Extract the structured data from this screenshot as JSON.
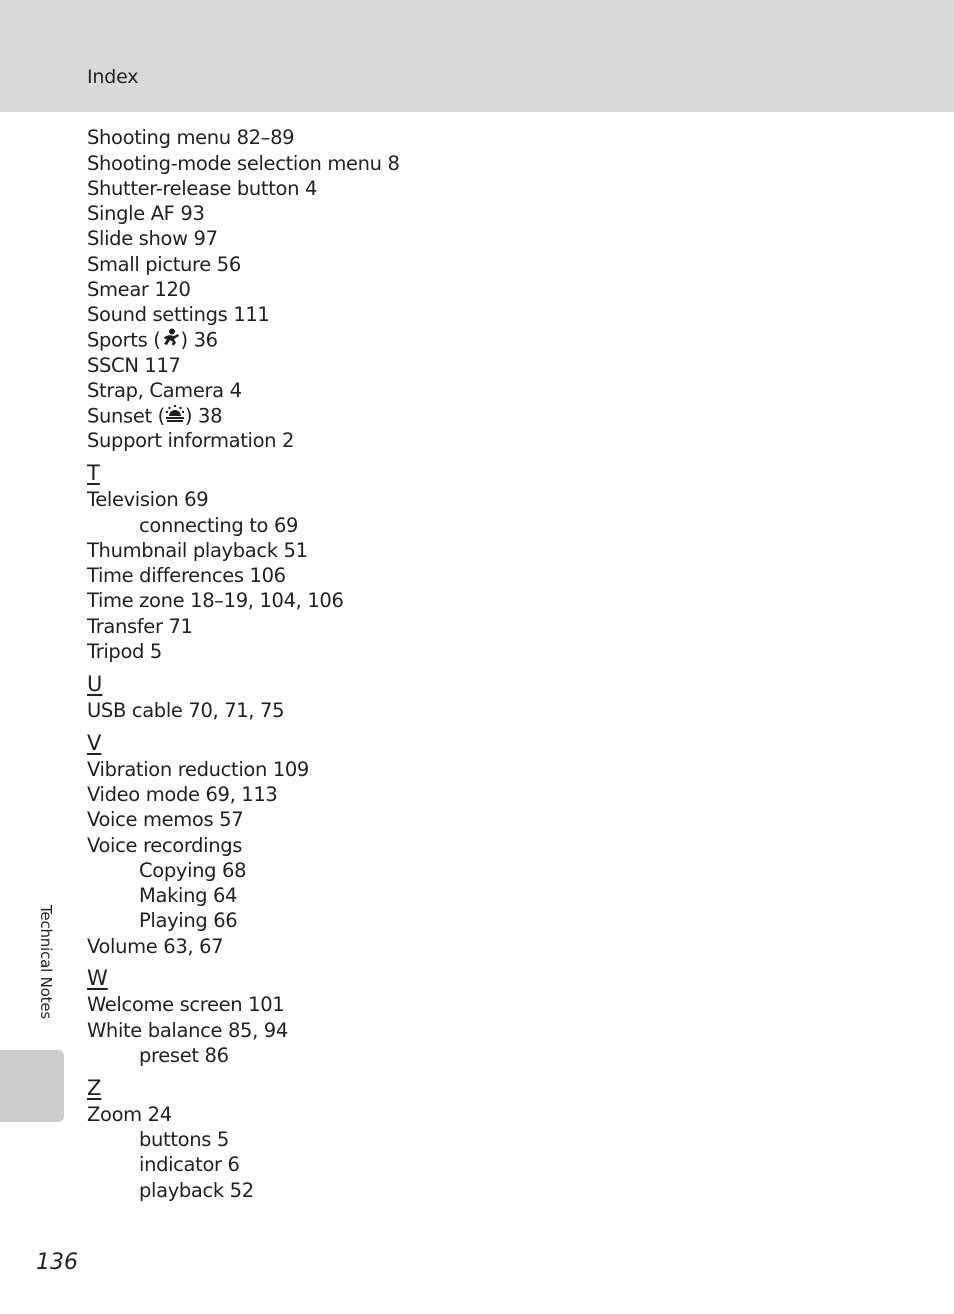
{
  "header": {
    "title": "Index"
  },
  "entries": [
    {
      "type": "entry",
      "text": "Shooting menu 82–89"
    },
    {
      "type": "entry",
      "text": "Shooting-mode selection menu 8"
    },
    {
      "type": "entry",
      "text": "Shutter-release button 4"
    },
    {
      "type": "entry",
      "text": "Single AF 93"
    },
    {
      "type": "entry",
      "text": "Slide show 97"
    },
    {
      "type": "entry",
      "text": "Small picture 56"
    },
    {
      "type": "entry",
      "text": "Smear 120"
    },
    {
      "type": "entry",
      "text": "Sound settings 111"
    },
    {
      "type": "entry",
      "text_before": "Sports (",
      "icon": "sports-scene-icon",
      "text_after": ") 36"
    },
    {
      "type": "entry",
      "text": "SSCN 117"
    },
    {
      "type": "entry",
      "text": "Strap, Camera 4"
    },
    {
      "type": "entry",
      "text_before": "Sunset (",
      "icon": "sunset-scene-icon",
      "text_after": ") 38"
    },
    {
      "type": "entry",
      "text": "Support information 2"
    },
    {
      "type": "letter",
      "text": "T"
    },
    {
      "type": "entry",
      "text": "Television 69"
    },
    {
      "type": "sub",
      "text": "connecting to 69"
    },
    {
      "type": "entry",
      "text": "Thumbnail playback 51"
    },
    {
      "type": "entry",
      "text": "Time differences 106"
    },
    {
      "type": "entry",
      "text": "Time zone 18–19, 104, 106"
    },
    {
      "type": "entry",
      "text": "Transfer 71"
    },
    {
      "type": "entry",
      "text": "Tripod 5"
    },
    {
      "type": "letter",
      "text": "U"
    },
    {
      "type": "entry",
      "text": "USB cable 70, 71, 75"
    },
    {
      "type": "letter",
      "text": "V"
    },
    {
      "type": "entry",
      "text": "Vibration reduction 109"
    },
    {
      "type": "entry",
      "text": "Video mode 69, 113"
    },
    {
      "type": "entry",
      "text": "Voice memos 57"
    },
    {
      "type": "entry",
      "text": "Voice recordings"
    },
    {
      "type": "sub",
      "text": "Copying 68"
    },
    {
      "type": "sub",
      "text": "Making 64"
    },
    {
      "type": "sub",
      "text": "Playing 66"
    },
    {
      "type": "entry",
      "text": "Volume 63, 67"
    },
    {
      "type": "letter",
      "text": "W"
    },
    {
      "type": "entry",
      "text": "Welcome screen 101"
    },
    {
      "type": "entry",
      "text": "White balance 85, 94"
    },
    {
      "type": "sub",
      "text": "preset 86"
    },
    {
      "type": "letter",
      "text": "Z"
    },
    {
      "type": "entry",
      "text": "Zoom 24"
    },
    {
      "type": "sub",
      "text": "buttons 5"
    },
    {
      "type": "sub",
      "text": "indicator 6"
    },
    {
      "type": "sub",
      "text": "playback 52"
    }
  ],
  "side_label": "Technical Notes",
  "page_number": "136"
}
